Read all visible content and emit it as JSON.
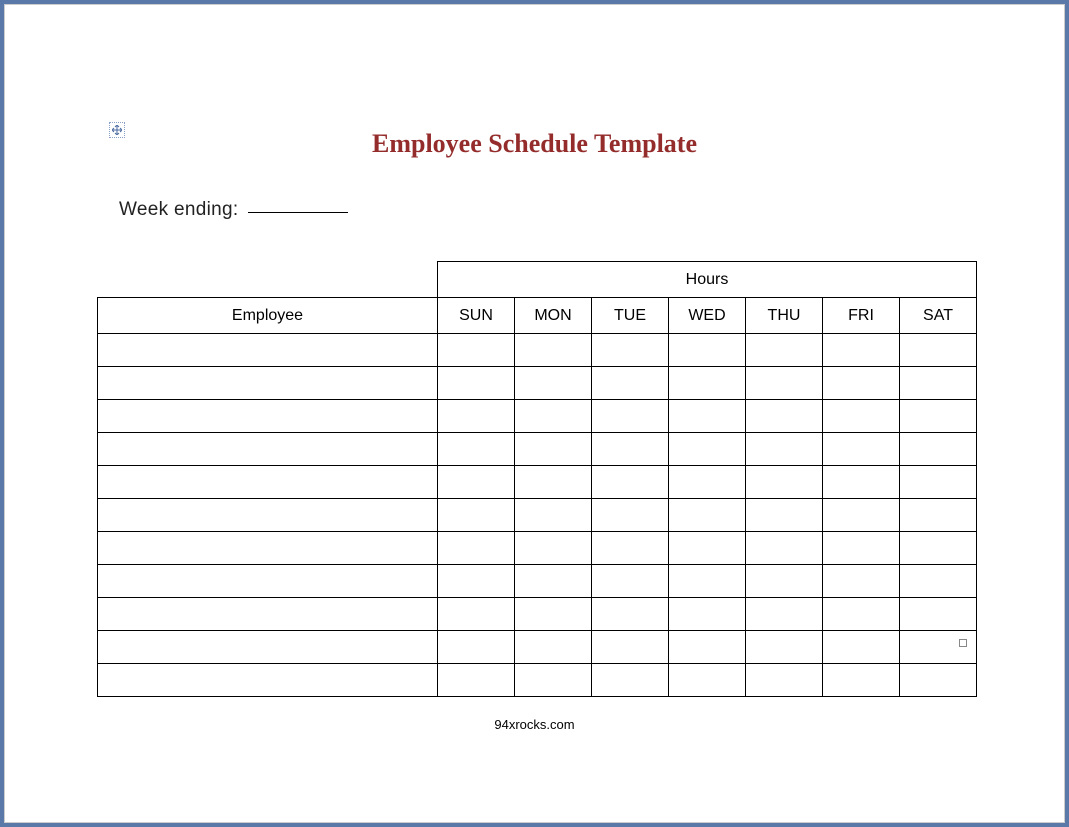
{
  "title": "Employee Schedule Template",
  "week_ending_label": "Week ending:",
  "table": {
    "hours_label": "Hours",
    "employee_label": "Employee",
    "days": [
      "SUN",
      "MON",
      "TUE",
      "WED",
      "THU",
      "FRI",
      "SAT"
    ],
    "blank_row_count": 11
  },
  "footer": "94xrocks.com"
}
